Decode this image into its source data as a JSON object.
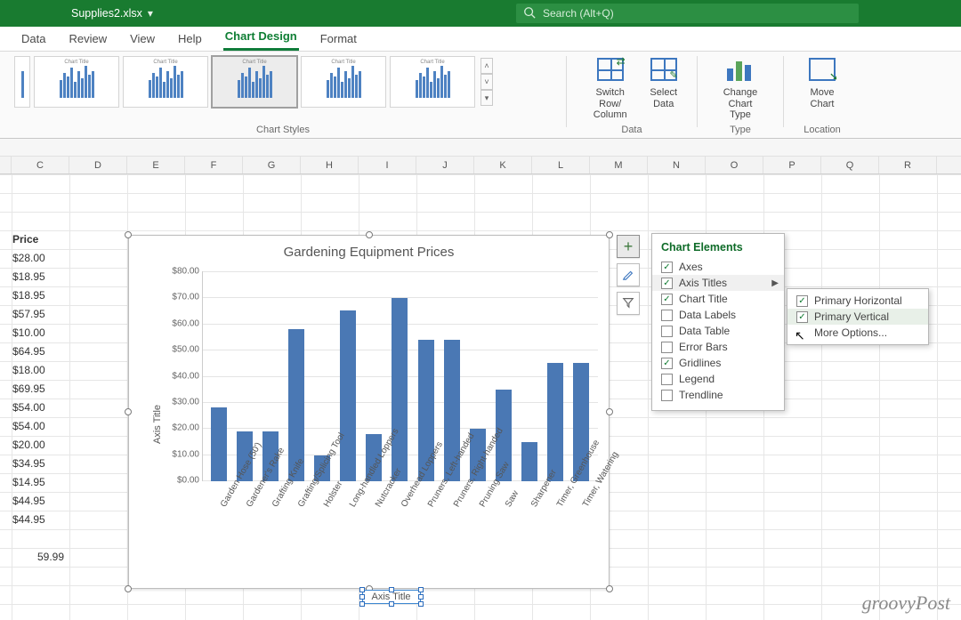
{
  "titlebar": {
    "filename": "Supplies2.xlsx"
  },
  "search": {
    "placeholder": "Search (Alt+Q)"
  },
  "tabs": [
    "Data",
    "Review",
    "View",
    "Help",
    "Chart Design",
    "Format"
  ],
  "activeTab": "Chart Design",
  "ribbon": {
    "group_styles_label": "Chart Styles",
    "thumb_title": "Chart Title",
    "group_data_label": "Data",
    "group_type_label": "Type",
    "group_location_label": "Location",
    "btn_switch": "Switch Row/\nColumn",
    "btn_select": "Select\nData",
    "btn_change": "Change\nChart Type",
    "btn_move": "Move\nChart"
  },
  "columns": [
    "C",
    "D",
    "E",
    "F",
    "G",
    "H",
    "I",
    "J",
    "K",
    "L",
    "M",
    "N",
    "O",
    "P",
    "Q",
    "R"
  ],
  "prices_header": "Price",
  "prices": [
    "$28.00",
    "$18.95",
    "$18.95",
    "$57.95",
    "$10.00",
    "$64.95",
    "$18.00",
    "$69.95",
    "$54.00",
    "$54.00",
    "$20.00",
    "$34.95",
    "$14.95",
    "$44.95",
    "$44.95",
    "",
    "59.99"
  ],
  "flyout_title": "Chart Elements",
  "chart_elements": [
    {
      "label": "Axes",
      "checked": true
    },
    {
      "label": "Axis Titles",
      "checked": true,
      "arrow": true
    },
    {
      "label": "Chart Title",
      "checked": true
    },
    {
      "label": "Data Labels",
      "checked": false
    },
    {
      "label": "Data Table",
      "checked": false
    },
    {
      "label": "Error Bars",
      "checked": false
    },
    {
      "label": "Gridlines",
      "checked": true
    },
    {
      "label": "Legend",
      "checked": false
    },
    {
      "label": "Trendline",
      "checked": false
    }
  ],
  "sub_items": [
    {
      "label": "Primary Horizontal",
      "checked": true
    },
    {
      "label": "Primary Vertical",
      "checked": true,
      "sel": true
    },
    {
      "label": "More Options..."
    }
  ],
  "chart_data": {
    "type": "bar",
    "title": "Gardening Equipment Prices",
    "ylabel": "Axis Title",
    "xlabel": "Axis Title",
    "ylim": [
      0,
      80
    ],
    "yticks": [
      "$0.00",
      "$10.00",
      "$20.00",
      "$30.00",
      "$40.00",
      "$50.00",
      "$60.00",
      "$70.00",
      "$80.00"
    ],
    "categories": [
      "Garden Hose (50')",
      "Gardener's Rake",
      "Grafting Knife",
      "Grafting/Splicing Tool",
      "Holster",
      "Long-handled Loppers",
      "Nutcracker",
      "Overhead Loppers",
      "Pruners, Left-handed",
      "Pruners, Right-handed",
      "Pruning Saw",
      "Saw",
      "Sharpener",
      "Timer, Greenhouse",
      "Timer, Watering"
    ],
    "values": [
      28.0,
      18.95,
      18.95,
      57.95,
      10.0,
      64.95,
      18.0,
      69.95,
      54.0,
      54.0,
      20.0,
      34.95,
      14.95,
      44.95,
      44.95
    ]
  },
  "watermark": "groovyPost"
}
